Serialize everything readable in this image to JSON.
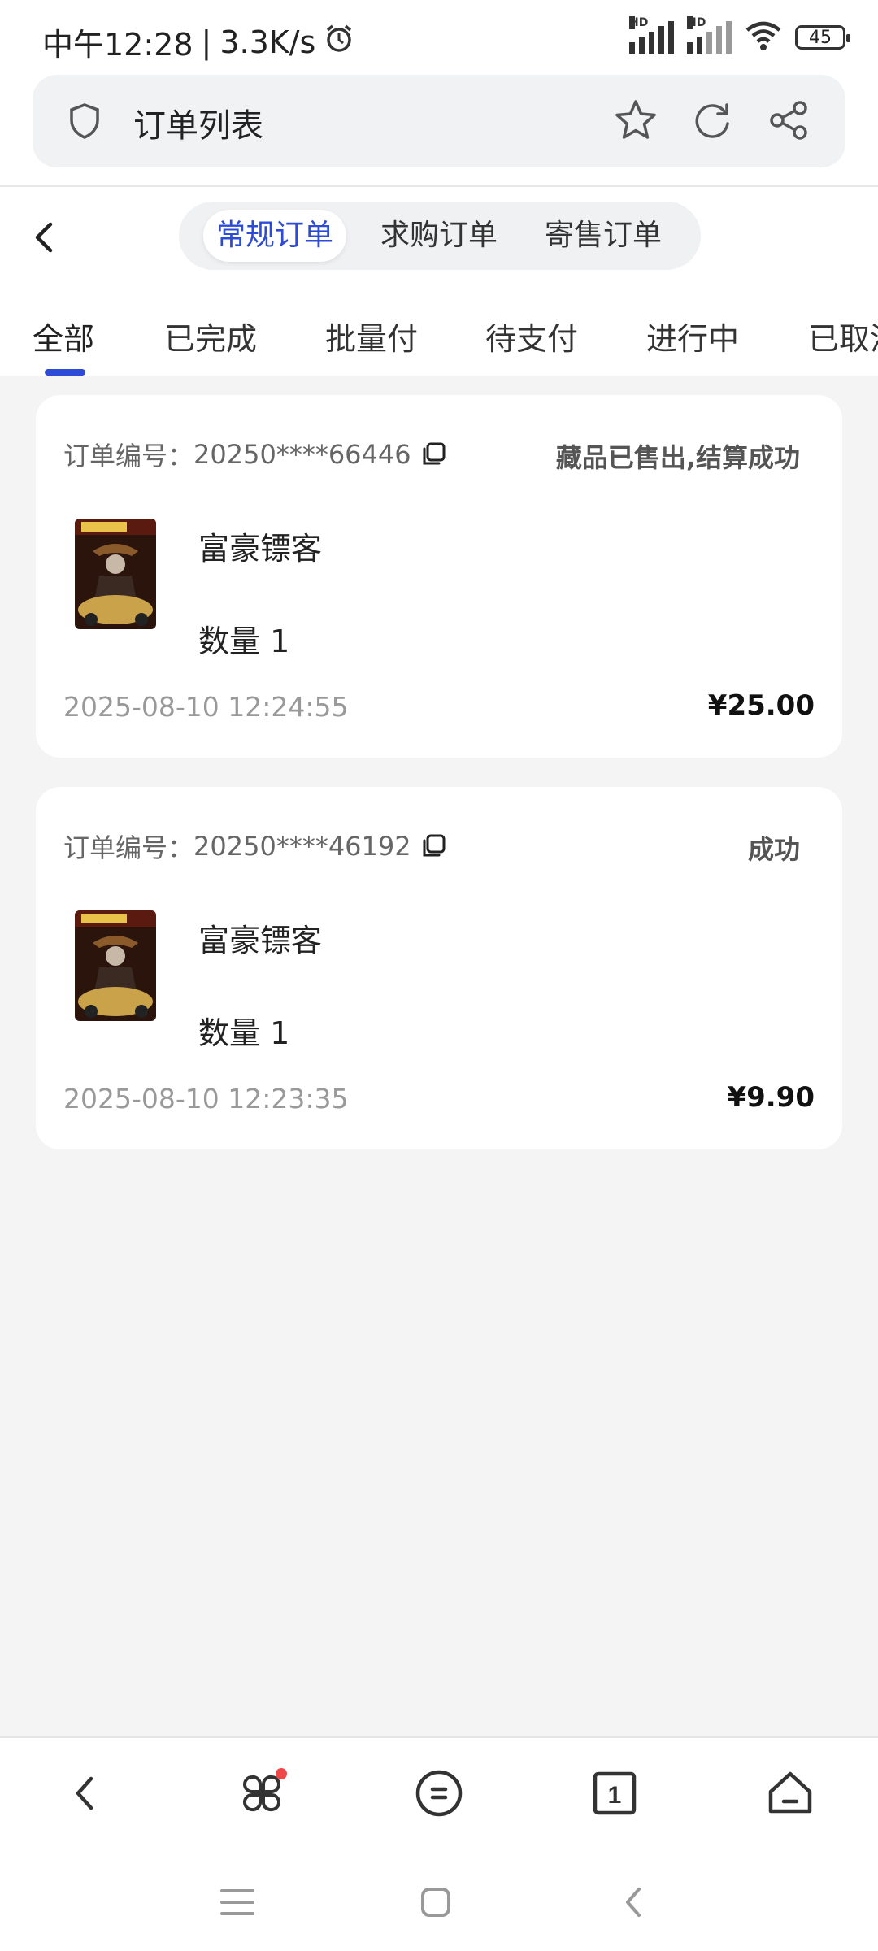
{
  "status_bar": {
    "time": "中午12:28",
    "separator": "|",
    "speed": "3.3K/s",
    "hd1": "HD",
    "hd2": "HD",
    "battery": "45",
    "icons": [
      "alarm-icon",
      "signal-icon",
      "signal-icon",
      "wifi-icon",
      "battery-icon"
    ]
  },
  "browser": {
    "title": "订单列表",
    "icons": [
      "shield-icon",
      "star-icon",
      "refresh-icon",
      "share-icon"
    ]
  },
  "header": {
    "segments": [
      "常规订单",
      "求购订单",
      "寄售订单"
    ],
    "active_segment": 0
  },
  "tabs": {
    "items": [
      "全部",
      "已完成",
      "批量付",
      "待支付",
      "进行中",
      "已取消"
    ],
    "active": 0,
    "accent_color": "#2d4bd6"
  },
  "orders": [
    {
      "order_label": "订单编号：",
      "order_no": "20250****66446",
      "status": "藏品已售出,结算成功",
      "product_name": "富豪镖客",
      "quantity": "数量 1",
      "time": "2025-08-10 12:24:55",
      "price": "¥25.00"
    },
    {
      "order_label": "订单编号：",
      "order_no": "20250****46192",
      "status": "成功",
      "product_name": "富豪镖客",
      "quantity": "数量 1",
      "time": "2025-08-10 12:23:35",
      "price": "¥9.90"
    }
  ],
  "bottom_bar": {
    "tab_count": "1",
    "icons": [
      "back-icon",
      "apps-icon",
      "menu-icon",
      "tabs-icon",
      "home-icon"
    ]
  },
  "system_nav": {
    "icons": [
      "recents-icon",
      "home-icon",
      "back-icon"
    ]
  }
}
